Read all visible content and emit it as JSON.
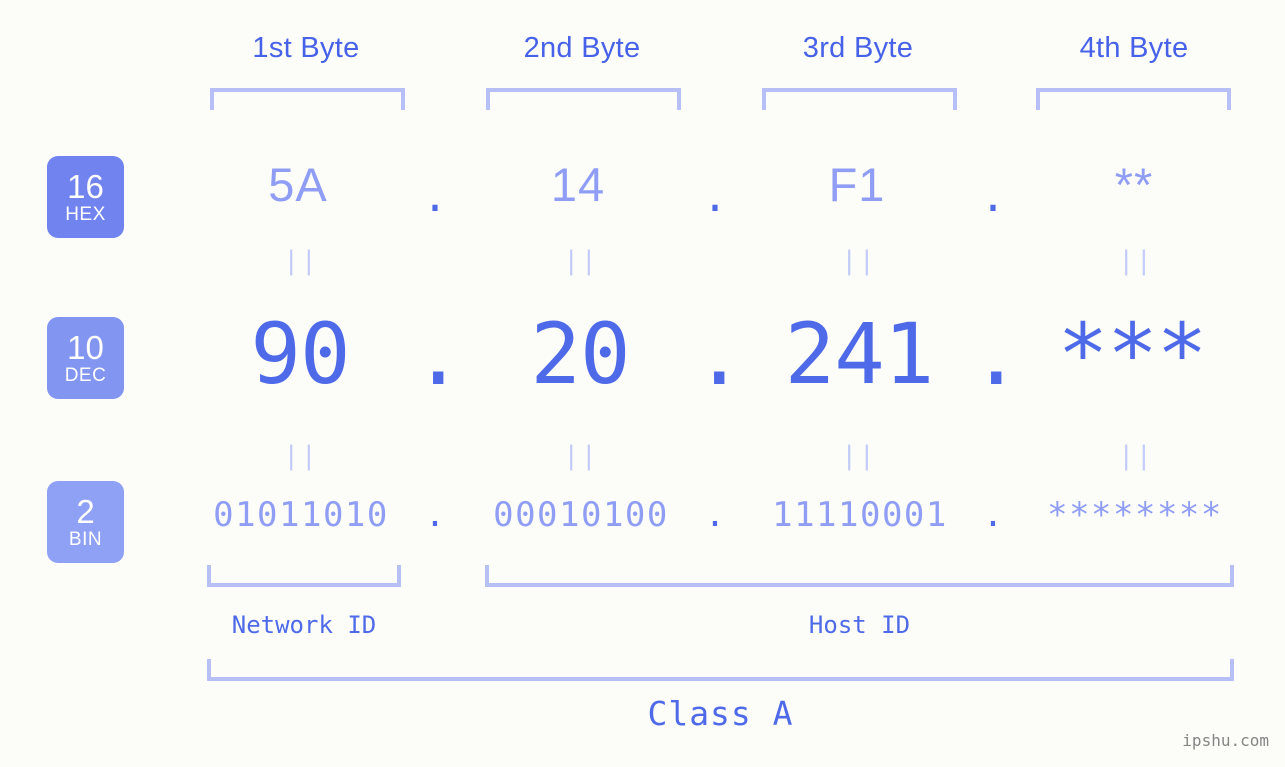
{
  "page": {
    "background_color": "#fcfdf8",
    "accent_dark": "#4f6ae8",
    "accent_light": "#8f9df5",
    "bracket_color": "#b6c0f7",
    "watermark": "ipshu.com"
  },
  "byte_headers": [
    {
      "label": "1st Byte"
    },
    {
      "label": "2nd Byte"
    },
    {
      "label": "3rd Byte"
    },
    {
      "label": "4th Byte"
    }
  ],
  "bases": [
    {
      "number": "16",
      "name": "HEX",
      "color": "#7183ef"
    },
    {
      "number": "10",
      "name": "DEC",
      "color": "#8295f0"
    },
    {
      "number": "2",
      "name": "BIN",
      "color": "#8fa1f4"
    }
  ],
  "rows": {
    "hex": {
      "base_number": "16",
      "base_name": "HEX",
      "values": [
        "5A",
        "14",
        "F1",
        "**"
      ],
      "separators": [
        ".",
        ".",
        "."
      ]
    },
    "dec": {
      "base_number": "10",
      "base_name": "DEC",
      "values": [
        "90",
        "20",
        "241",
        "***"
      ],
      "separators": [
        ".",
        ".",
        "."
      ]
    },
    "bin": {
      "base_number": "2",
      "base_name": "BIN",
      "values": [
        "01011010",
        "00010100",
        "11110001",
        "********"
      ],
      "separators": [
        ".",
        ".",
        "."
      ]
    }
  },
  "equals_markers": {
    "symbol": "||",
    "hex_to_dec": [
      "||",
      "||",
      "||",
      "||"
    ],
    "dec_to_bin": [
      "||",
      "||",
      "||",
      "||"
    ]
  },
  "sections": {
    "network_id": "Network ID",
    "host_id": "Host ID",
    "class": "Class A"
  }
}
